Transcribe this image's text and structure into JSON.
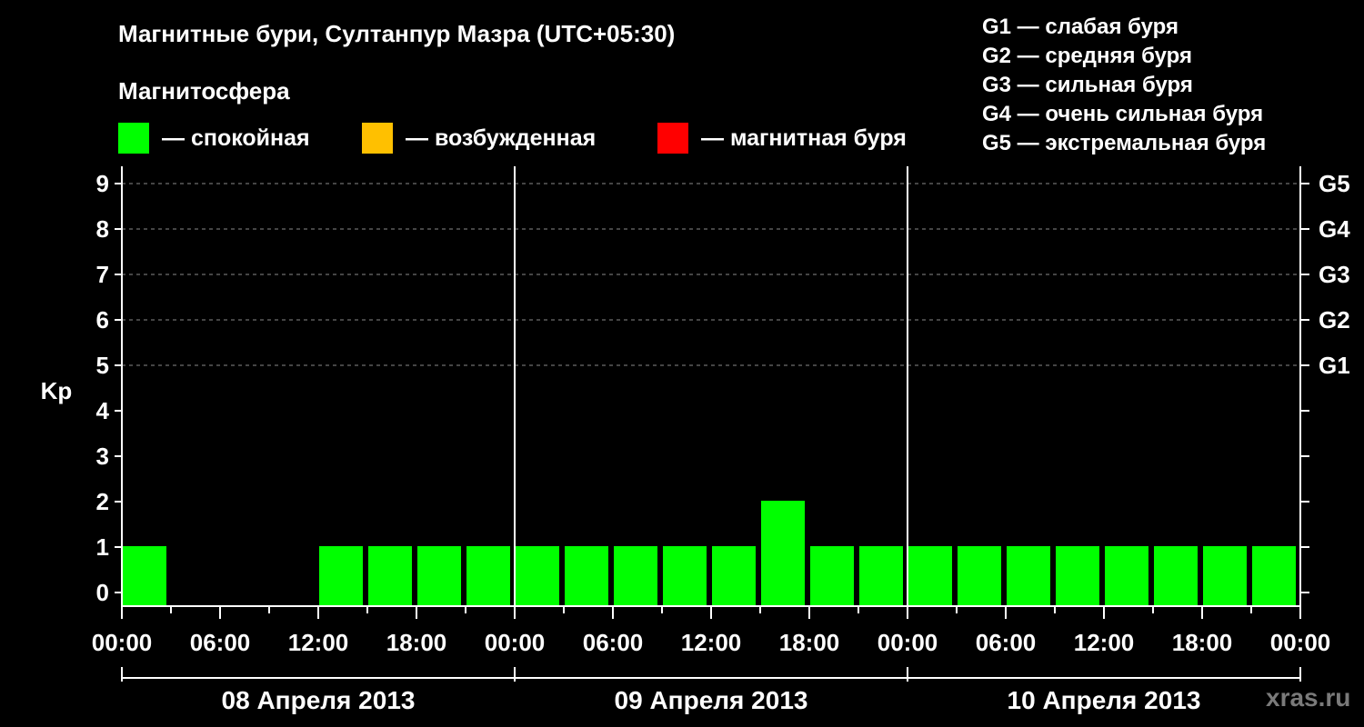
{
  "title": "Магнитные бури, Султанпур Мазра (UTC+05:30)",
  "magnetosphere": {
    "title": "Магнитосфера",
    "legend": [
      {
        "label": "— спокойная",
        "color": "#00ff00"
      },
      {
        "label": "— возбужденная",
        "color": "#ffc000"
      },
      {
        "label": "— магнитная буря",
        "color": "#ff0000"
      }
    ]
  },
  "g_scale_legend": [
    "G1 — слабая буря",
    "G2 — средняя буря",
    "G3 — сильная буря",
    "G4 — очень сильная буря",
    "G5 — экстремальная буря"
  ],
  "watermark": "xras.ru",
  "chart_data": {
    "type": "bar",
    "ylabel": "Kp",
    "ylim": [
      0,
      9
    ],
    "y_ticks": [
      "0",
      "1",
      "2",
      "3",
      "4",
      "5",
      "6",
      "7",
      "8",
      "9"
    ],
    "right_axis_labels": [
      {
        "kp": 5,
        "label": "G1"
      },
      {
        "kp": 6,
        "label": "G2"
      },
      {
        "kp": 7,
        "label": "G3"
      },
      {
        "kp": 8,
        "label": "G4"
      },
      {
        "kp": 9,
        "label": "G5"
      }
    ],
    "grid": "dashed horizontal at Kp 5–9",
    "x_tick_labels": [
      "00:00",
      "06:00",
      "12:00",
      "18:00",
      "00:00",
      "06:00",
      "12:00",
      "18:00",
      "00:00",
      "06:00",
      "12:00",
      "18:00",
      "00:00"
    ],
    "dates": [
      "08 Апреля 2013",
      "09 Апреля 2013",
      "10 Апреля 2013"
    ],
    "interval_hours": 3,
    "values": [
      1,
      0,
      0,
      0,
      1,
      1,
      1,
      1,
      1,
      1,
      1,
      1,
      1,
      2,
      1,
      1,
      1,
      1,
      1,
      1,
      1,
      1,
      1,
      1
    ]
  }
}
